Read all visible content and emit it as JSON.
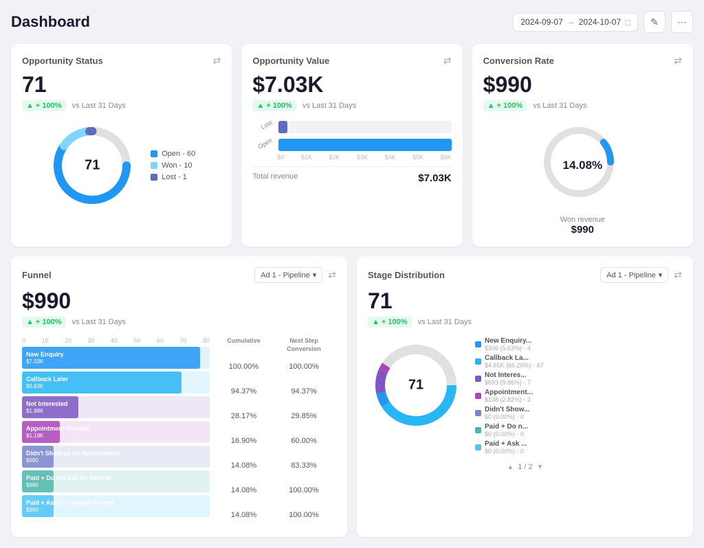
{
  "header": {
    "title": "Dashboard",
    "date_start": "2024-09-07",
    "date_end": "2024-10-07",
    "date_arrow": "→",
    "edit_icon": "✎",
    "more_icon": "⋯",
    "calendar_icon": "□"
  },
  "opportunity_status": {
    "title": "Opportunity Status",
    "value": "71",
    "badge": "+ 100%",
    "badge_sub": "vs Last 31 Days",
    "donut_center": "71",
    "legend": [
      {
        "label": "Open - 60",
        "color": "#2196F3"
      },
      {
        "label": "Won - 10",
        "color": "#81D4FA"
      },
      {
        "label": "Lost - 1",
        "color": "#5C6BC0"
      }
    ]
  },
  "opportunity_value": {
    "title": "Opportunity Value",
    "value": "$7.03K",
    "badge": "+ 100%",
    "badge_sub": "vs Last 31 Days",
    "bars": [
      {
        "label": "Lost",
        "pct": 5,
        "color": "#5C6BC0"
      },
      {
        "label": "Open",
        "pct": 100,
        "color": "#2196F3"
      }
    ],
    "axis_labels": [
      "$0",
      "$1K",
      "$2K",
      "$3K",
      "$4K",
      "$5K",
      "$6K"
    ],
    "total_label": "Total revenue",
    "total_value": "$7.03K"
  },
  "conversion_rate": {
    "title": "Conversion Rate",
    "value": "$990",
    "badge": "+ 100%",
    "badge_sub": "vs Last 31 Days",
    "donut_pct": "14.08%",
    "won_label": "Won revenue",
    "won_value": "$990"
  },
  "funnel": {
    "title": "Funnel",
    "pipeline_label": "Ad 1 - Pipeline",
    "value": "$990",
    "badge": "+ 100%",
    "badge_sub": "vs Last 31 Days",
    "axis_numbers": [
      "0",
      "10",
      "20",
      "30",
      "40",
      "50",
      "60",
      "70",
      "80"
    ],
    "col1_header": "Cumulative",
    "col2_header": "Next Step Conversion",
    "rows": [
      {
        "label": "New Enquiry",
        "sub": "$7.03K",
        "bar_pct": 95,
        "color": "#2196F3",
        "cum": "100.00%",
        "next": "100.00%"
      },
      {
        "label": "Callback Later",
        "sub": "$6.63K",
        "bar_pct": 88,
        "color": "#29B6F6",
        "cum": "94.37%",
        "next": "94.37%"
      },
      {
        "label": "Not Interested",
        "sub": "$1.98K",
        "bar_pct": 35,
        "color": "#7E57C2",
        "cum": "28.17%",
        "next": "29.85%"
      },
      {
        "label": "Appointment Booked",
        "sub": "$1.19K",
        "bar_pct": 22,
        "color": "#AB47BC",
        "cum": "16.90%",
        "next": "60.00%"
      },
      {
        "label": "Didn't Show up on Appointment",
        "sub": "$990",
        "bar_pct": 18,
        "color": "#7986CB",
        "cum": "14.08%",
        "next": "83.33%"
      },
      {
        "label": "Paid + Do not ask for Review",
        "sub": "$990",
        "bar_pct": 18,
        "color": "#4DB6AC",
        "cum": "14.08%",
        "next": "100.00%"
      },
      {
        "label": "Paid + Ask for Google Review",
        "sub": "$990",
        "bar_pct": 18,
        "color": "#4FC3F7",
        "cum": "14.08%",
        "next": "100.00%"
      }
    ]
  },
  "stage_distribution": {
    "title": "Stage Distribution",
    "pipeline_label": "Ad 1 - Pipeline",
    "value": "71",
    "badge": "+ 100%",
    "badge_sub": "vs Last 31 Days",
    "donut_center": "71",
    "legend": [
      {
        "label": "New Enquiry...",
        "sub": "$396 (5.63%) - 4",
        "color": "#2196F3"
      },
      {
        "label": "Callback La...",
        "sub": "$4.65K (66.20%) - 47",
        "color": "#29B6F6"
      },
      {
        "label": "Not Interes...",
        "sub": "$693 (9.86%) - 7",
        "color": "#7E57C2"
      },
      {
        "label": "Appointment...",
        "sub": "$198 (2.82%) - 2",
        "color": "#AB47BC"
      },
      {
        "label": "Didn't Show...",
        "sub": "$0 (0.00%) - 0",
        "color": "#7986CB"
      },
      {
        "label": "Paid + Do n...",
        "sub": "$0 (0.00%) - 0",
        "color": "#4DB6AC"
      },
      {
        "label": "Paid + Ask ...",
        "sub": "$0 (0.00%) - 0",
        "color": "#4FC3F7"
      }
    ],
    "pagination": "1 / 2"
  }
}
